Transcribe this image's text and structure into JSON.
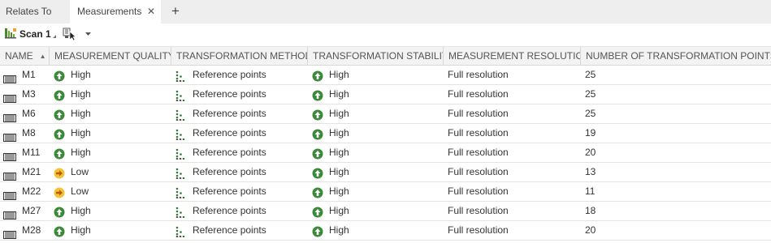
{
  "tabs": {
    "relates_to": "Relates To",
    "measurements": "Measurements",
    "close_glyph": "✕",
    "add_glyph": "+"
  },
  "toolbar": {
    "scan_label": "Scan 1",
    "scan_icon": "scan-icon",
    "tool_icon": "select-pointer-icon",
    "dropdown_icon": "dropdown-arrow-icon"
  },
  "table": {
    "headers": {
      "name": "NAME",
      "quality": "MEASUREMENT QUALITY",
      "method": "TRANSFORMATION METHOD",
      "stability": "TRANSFORMATION STABILITY",
      "resolution": "MEASUREMENT RESOLUTION",
      "points": "NUMBER OF TRANSFORMATION POINTS"
    },
    "sort": {
      "column": "name",
      "direction": "ascending"
    },
    "rows": [
      {
        "name": "M1",
        "quality": "High",
        "quality_icon": "up-arrow-green-icon",
        "method": "Reference points",
        "stability": "High",
        "resolution": "Full resolution",
        "points": "25"
      },
      {
        "name": "M3",
        "quality": "High",
        "quality_icon": "up-arrow-green-icon",
        "method": "Reference points",
        "stability": "High",
        "resolution": "Full resolution",
        "points": "25"
      },
      {
        "name": "M6",
        "quality": "High",
        "quality_icon": "up-arrow-green-icon",
        "method": "Reference points",
        "stability": "High",
        "resolution": "Full resolution",
        "points": "25"
      },
      {
        "name": "M8",
        "quality": "High",
        "quality_icon": "up-arrow-green-icon",
        "method": "Reference points",
        "stability": "High",
        "resolution": "Full resolution",
        "points": "19"
      },
      {
        "name": "M11",
        "quality": "High",
        "quality_icon": "up-arrow-green-icon",
        "method": "Reference points",
        "stability": "High",
        "resolution": "Full resolution",
        "points": "20"
      },
      {
        "name": "M21",
        "quality": "Low",
        "quality_icon": "right-arrow-yellow-icon",
        "method": "Reference points",
        "stability": "High",
        "resolution": "Full resolution",
        "points": "13"
      },
      {
        "name": "M22",
        "quality": "Low",
        "quality_icon": "right-arrow-yellow-icon",
        "method": "Reference points",
        "stability": "High",
        "resolution": "Full resolution",
        "points": "11"
      },
      {
        "name": "M27",
        "quality": "High",
        "quality_icon": "up-arrow-green-icon",
        "method": "Reference points",
        "stability": "High",
        "resolution": "Full resolution",
        "points": "18"
      },
      {
        "name": "M28",
        "quality": "High",
        "quality_icon": "up-arrow-green-icon",
        "method": "Reference points",
        "stability": "High",
        "resolution": "Full resolution",
        "points": "20"
      }
    ]
  },
  "colors": {
    "high_green": "#3a8a3a",
    "low_yellow": "#f0b400",
    "low_arrow": "#c05a00",
    "reference_green": "#2e7d32"
  }
}
